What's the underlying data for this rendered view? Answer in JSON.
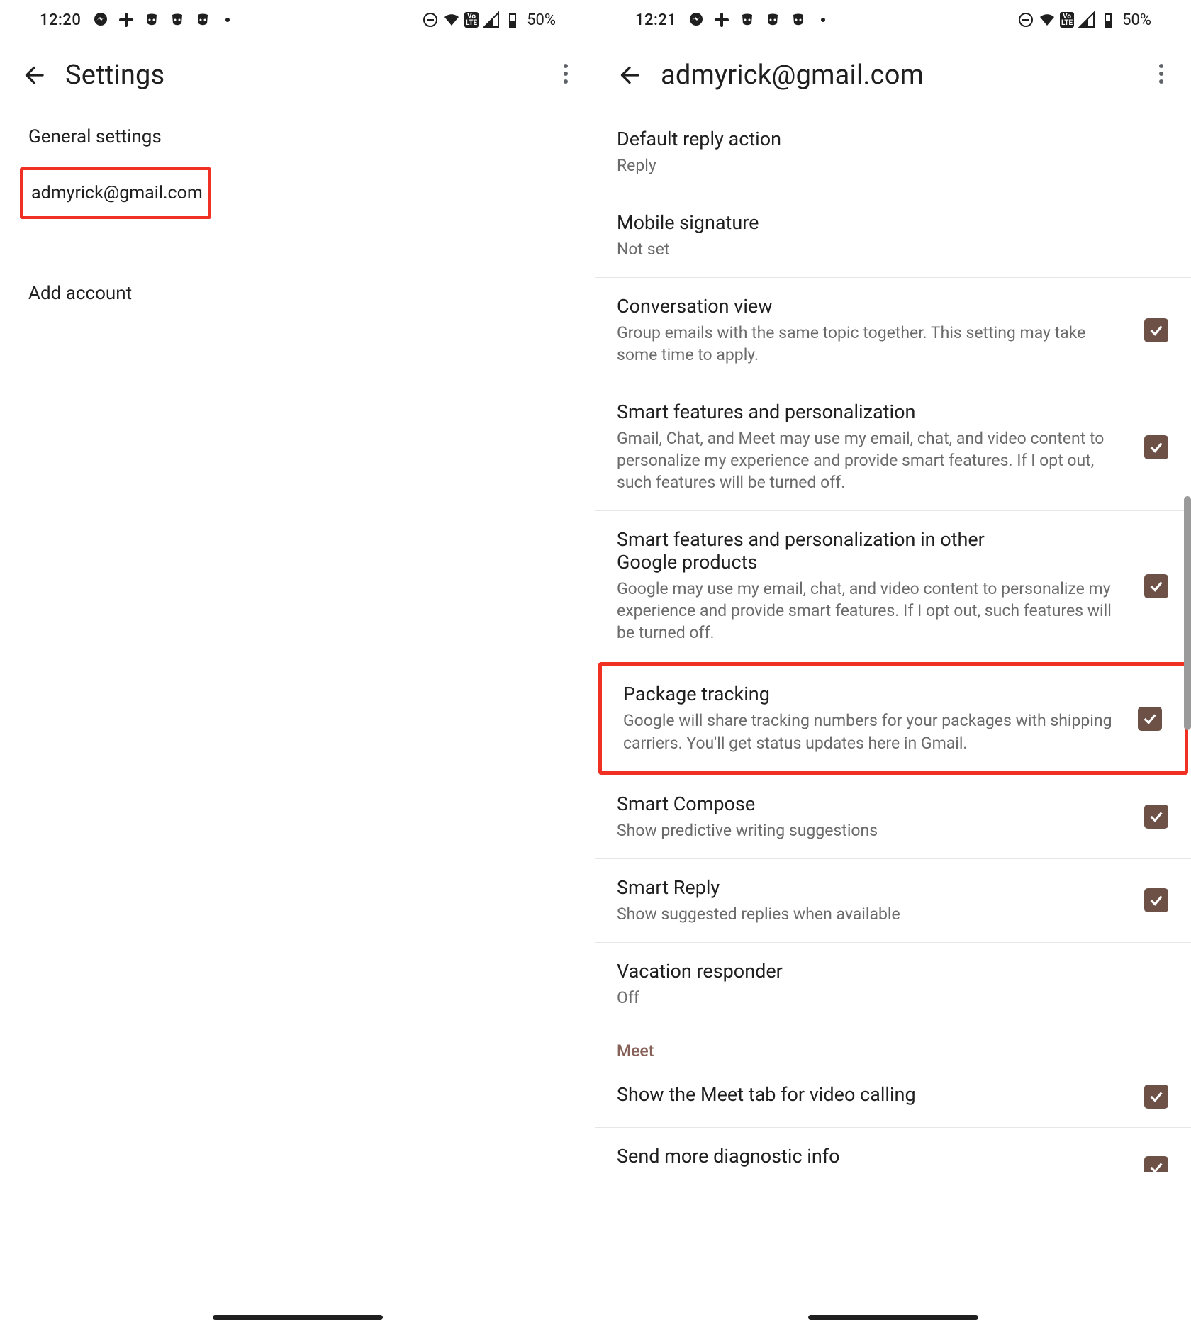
{
  "left": {
    "status_time": "12:20",
    "battery": "50%",
    "title": "Settings",
    "rows": {
      "general": "General settings",
      "account": "admyrick@gmail.com",
      "add": "Add account"
    }
  },
  "right": {
    "status_time": "12:21",
    "battery": "50%",
    "title": "admyrick@gmail.com",
    "settings": {
      "default_reply": {
        "title": "Default reply action",
        "sub": "Reply"
      },
      "signature": {
        "title": "Mobile signature",
        "sub": "Not set"
      },
      "conversation": {
        "title": "Conversation view",
        "sub": "Group emails with the same topic together. This setting may take some time to apply."
      },
      "smart_features": {
        "title": "Smart features and personalization",
        "sub": "Gmail, Chat, and Meet may use my email, chat, and video content to personalize my experience and provide smart features. If I opt out, such features will be turned off."
      },
      "smart_other": {
        "title": "Smart features and personalization in other Google products",
        "sub": "Google may use my email, chat, and video content to personalize my experience and provide smart features. If I opt out, such features will be turned off."
      },
      "package": {
        "title": "Package tracking",
        "sub": "Google will share tracking numbers for your packages with shipping carriers. You'll get status updates here in Gmail."
      },
      "smart_compose": {
        "title": "Smart Compose",
        "sub": "Show predictive writing suggestions"
      },
      "smart_reply": {
        "title": "Smart Reply",
        "sub": "Show suggested replies when available"
      },
      "vacation": {
        "title": "Vacation responder",
        "sub": "Off"
      },
      "section_meet": "Meet",
      "meet_tab": {
        "title": "Show the Meet tab for video calling"
      },
      "diag": {
        "title": "Send more diagnostic info"
      }
    }
  }
}
